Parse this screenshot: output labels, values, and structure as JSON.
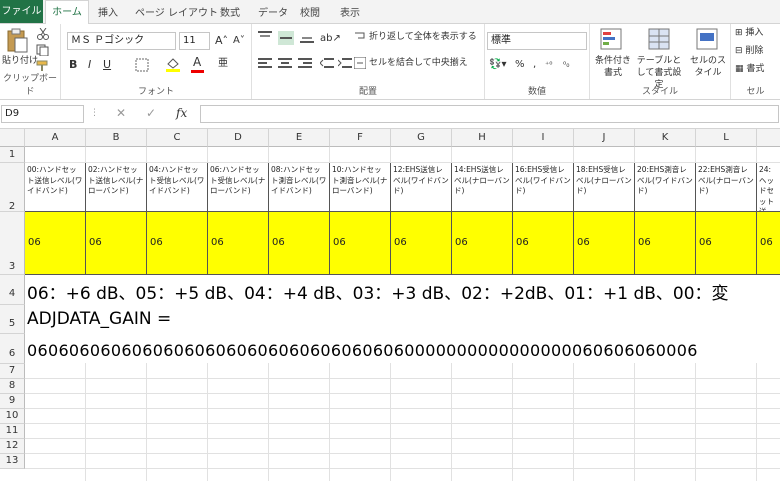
{
  "tabs": [
    "ファイル",
    "ホーム",
    "挿入",
    "ページ レイアウト",
    "数式",
    "データ",
    "校閲",
    "表示"
  ],
  "ribbon": {
    "clipboard": {
      "paste": "貼り付け",
      "label": "クリップボード"
    },
    "font": {
      "name": "ＭＳ Ｐゴシック",
      "size": "11",
      "label": "フォント"
    },
    "alignment": {
      "wrap": "折り返して全体を表示する",
      "merge": "セルを結合して中央揃え",
      "label": "配置"
    },
    "number": {
      "format": "標準",
      "label": "数値"
    },
    "styles": {
      "conditional": "条件付き書式",
      "table": "テーブルとして書式設定",
      "cellstyle": "セルのスタイル",
      "label": "スタイル"
    },
    "cells": {
      "insert": "挿入",
      "delete": "削除",
      "format": "書式",
      "label": "セル"
    }
  },
  "formula_bar": {
    "name_box": "D9",
    "cancel": "✕",
    "enter": "✓",
    "fx": "fx",
    "value": ""
  },
  "columns": [
    "A",
    "B",
    "C",
    "D",
    "E",
    "F",
    "G",
    "H",
    "I",
    "J",
    "K",
    "L"
  ],
  "rows": [
    "1",
    "2",
    "3",
    "4",
    "5",
    "6",
    "7",
    "8",
    "9",
    "10",
    "11",
    "12",
    "13"
  ],
  "header_cells": [
    "00:ハンドセット送信レベル(ワイドバンド)",
    "02:ハンドセット送信レベル(ナローバンド)",
    "04:ハンドセット受信レベル(ワイドバンド)",
    "06:ハンドセット受信レベル(ナローバンド)",
    "08:ハンドセット測音レベル(ワイドバンド)",
    "10:ハンドセット測音レベル(ナローバンド)",
    "12:EHS送信レベル(ワイドバンド)",
    "14:EHS送信レベル(ナローバンド)",
    "16:EHS受信レベル(ワイドバンド)",
    "18:EHS受信レベル(ナローバンド)",
    "20:EHS測音レベル(ワイドバンド)",
    "22:EHS測音レベル(ナローバンド)",
    "24:ヘッドセット送"
  ],
  "value_cells": [
    "06",
    "06",
    "06",
    "06",
    "06",
    "06",
    "06",
    "06",
    "06",
    "06",
    "06",
    "06",
    "06"
  ],
  "row4_text": "06：+6 dB、05：+5 dB、04：+4 dB、03：+3 dB、02：+2dB、01：+1 dB、00：変",
  "row5_text": "ADJDATA_GAIN =",
  "row6_text": "0606060606060606060606060606060606060000000000000000060606060006"
}
